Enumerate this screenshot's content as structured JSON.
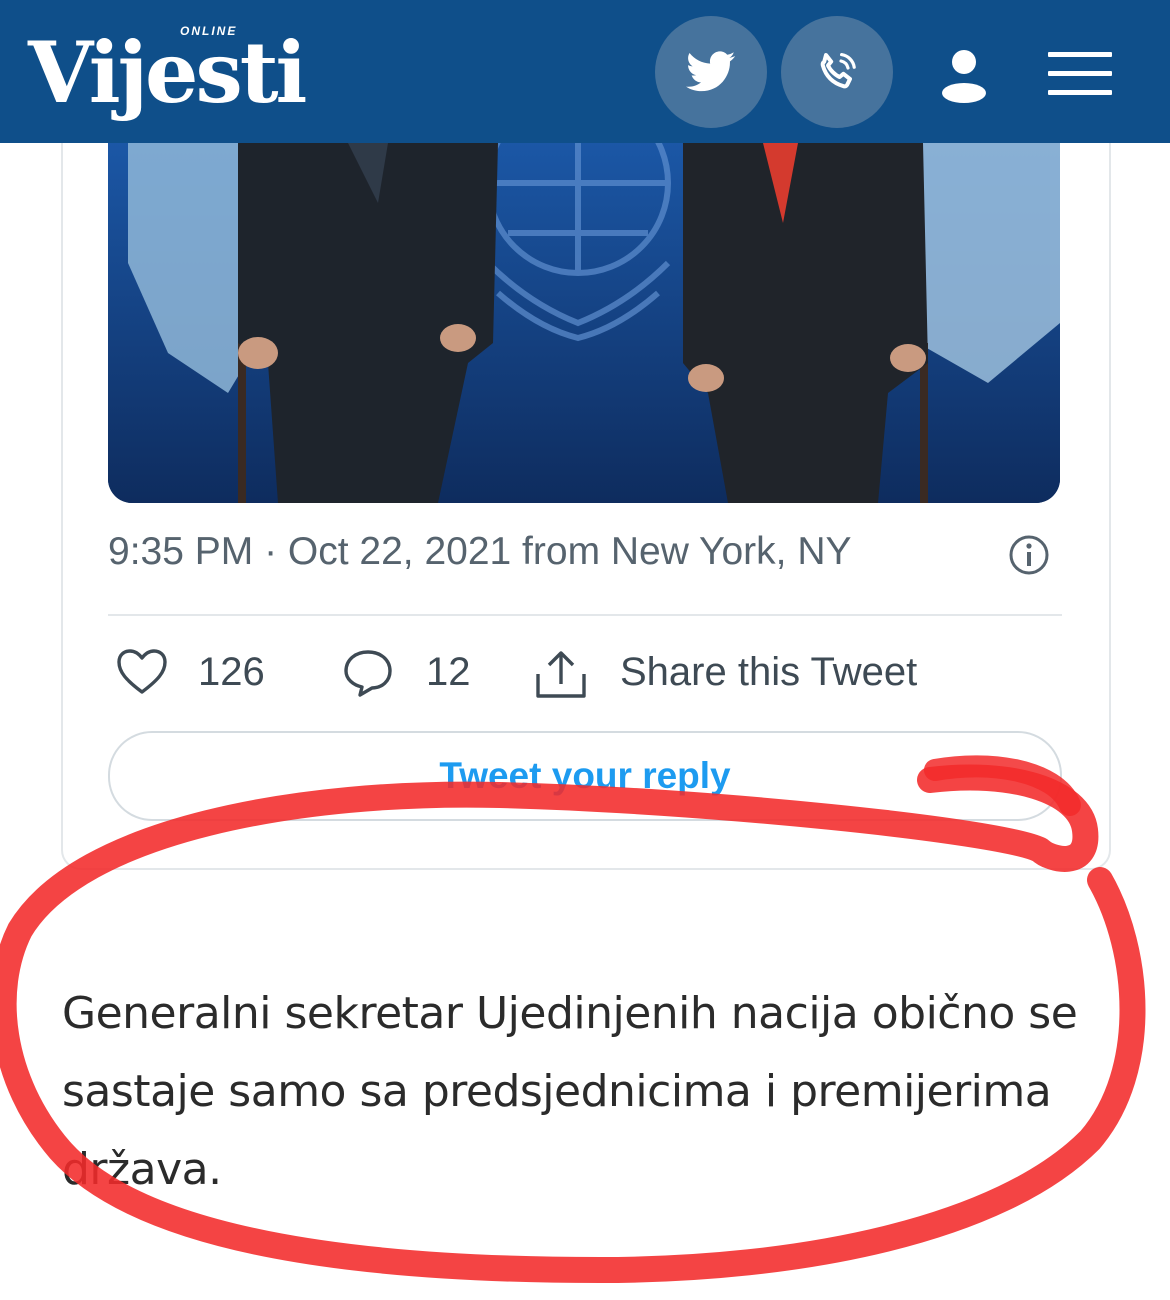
{
  "header": {
    "logo_text": "Vijesti",
    "logo_sub": "ONLINE",
    "bg_color": "#0f4f8a",
    "buttons": [
      {
        "name": "twitter-button",
        "icon": "twitter-bird-icon"
      },
      {
        "name": "phone-button",
        "icon": "phone-icon"
      },
      {
        "name": "user-button",
        "icon": "user-icon"
      },
      {
        "name": "menu-button",
        "icon": "hamburger-menu-icon"
      }
    ]
  },
  "tweet": {
    "meta": "9:35 PM · Oct 22, 2021 from New York, NY",
    "likes": "126",
    "replies": "12",
    "share_label": "Share this Tweet",
    "reply_placeholder": "Tweet your reply"
  },
  "article": {
    "paragraph": "Generalni sekretar Ujedinjenih nacija obično se sastaje samo sa predsjednicima i premijerima država."
  },
  "colors": {
    "twitter_blue": "#1d9bf0",
    "annotation_red": "#f22a2a"
  }
}
